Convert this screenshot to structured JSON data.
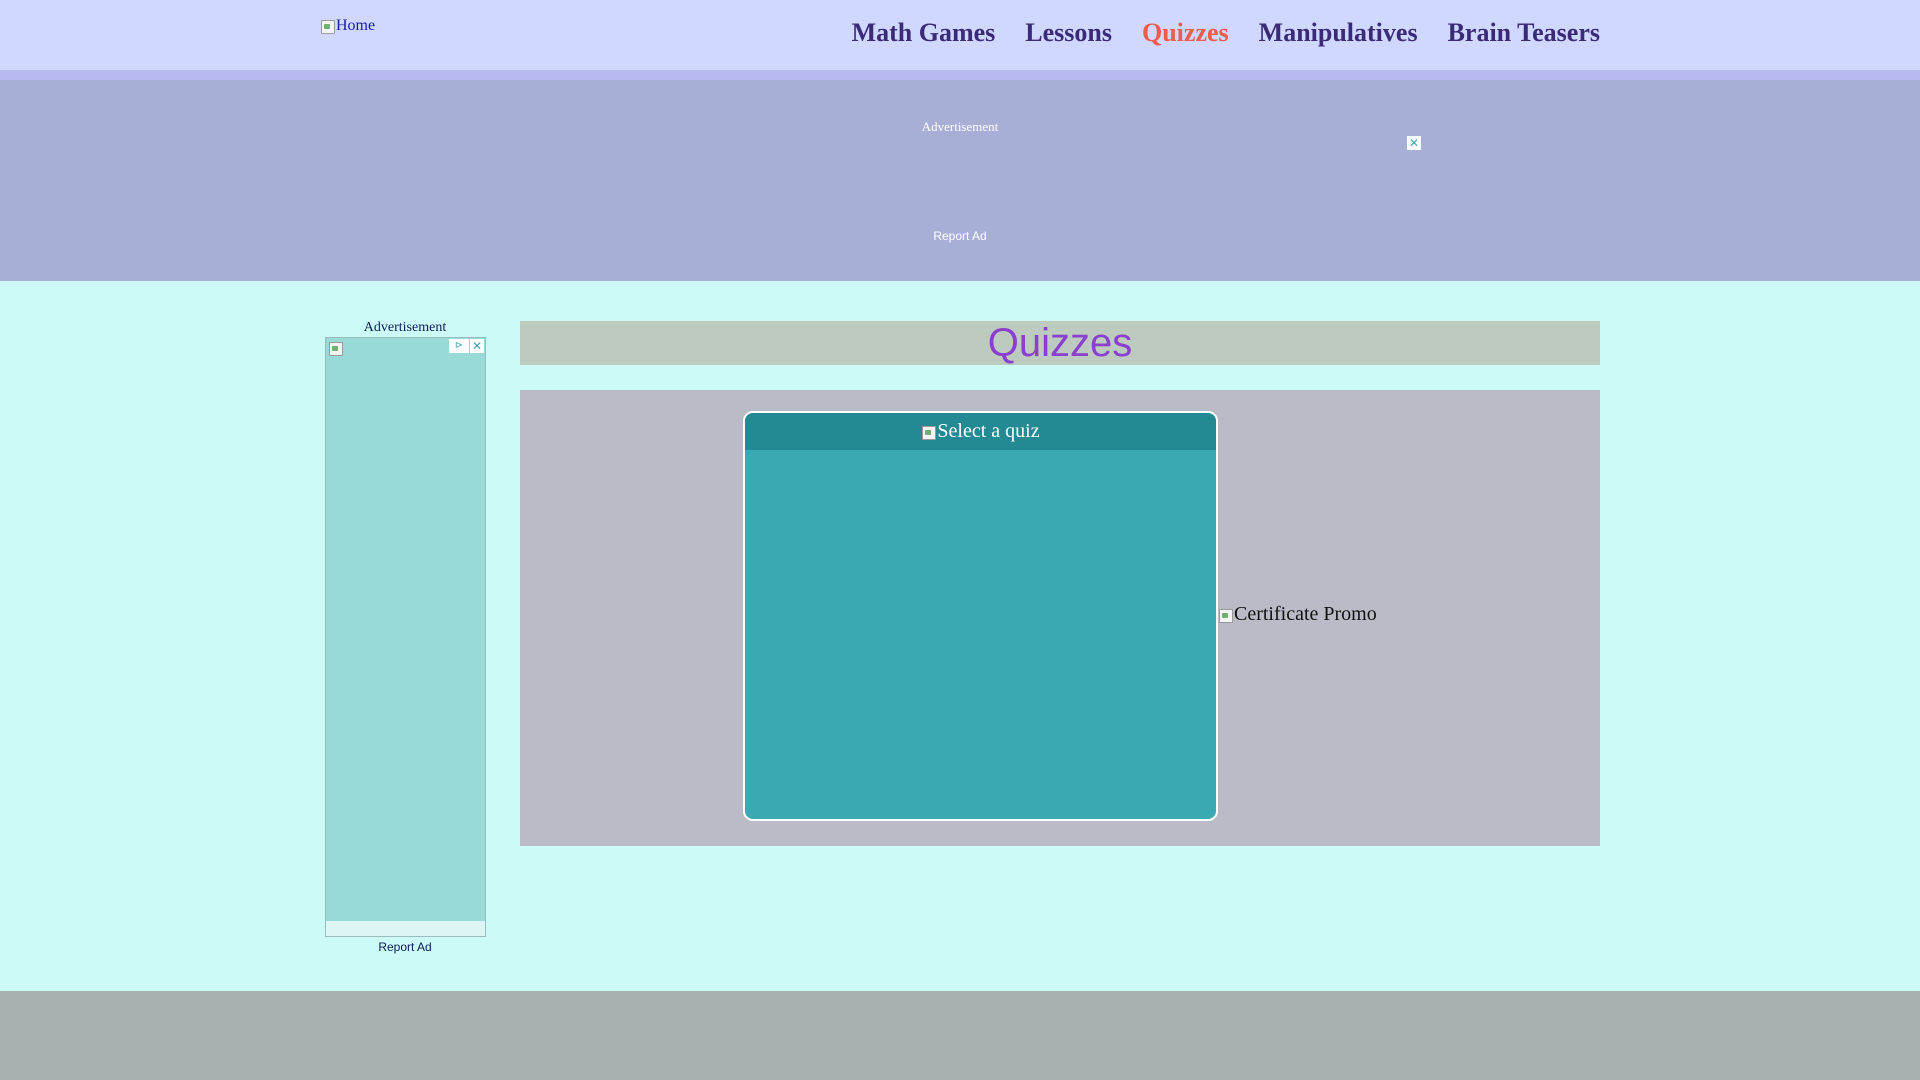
{
  "header": {
    "home_alt": "Home",
    "nav": [
      {
        "label": "Math Games",
        "active": false
      },
      {
        "label": "Lessons",
        "active": false
      },
      {
        "label": "Quizzes",
        "active": true
      },
      {
        "label": "Manipulatives",
        "active": false
      },
      {
        "label": "Brain Teasers",
        "active": false
      }
    ]
  },
  "top_ad": {
    "label": "Advertisement",
    "report": "Report Ad"
  },
  "side_ad": {
    "label": "Advertisement",
    "report": "Report Ad"
  },
  "main": {
    "title": "Quizzes",
    "quiz_header_alt": "Select a quiz",
    "promo_alt": "Certificate Promo"
  },
  "colors": {
    "header_bg": "#d0d8ff",
    "nav_text": "#3b2a78",
    "nav_active": "#f05b4a",
    "title_text": "#8b3ed0",
    "quiz_box": "#3aa9b2",
    "quiz_header": "#238992"
  }
}
